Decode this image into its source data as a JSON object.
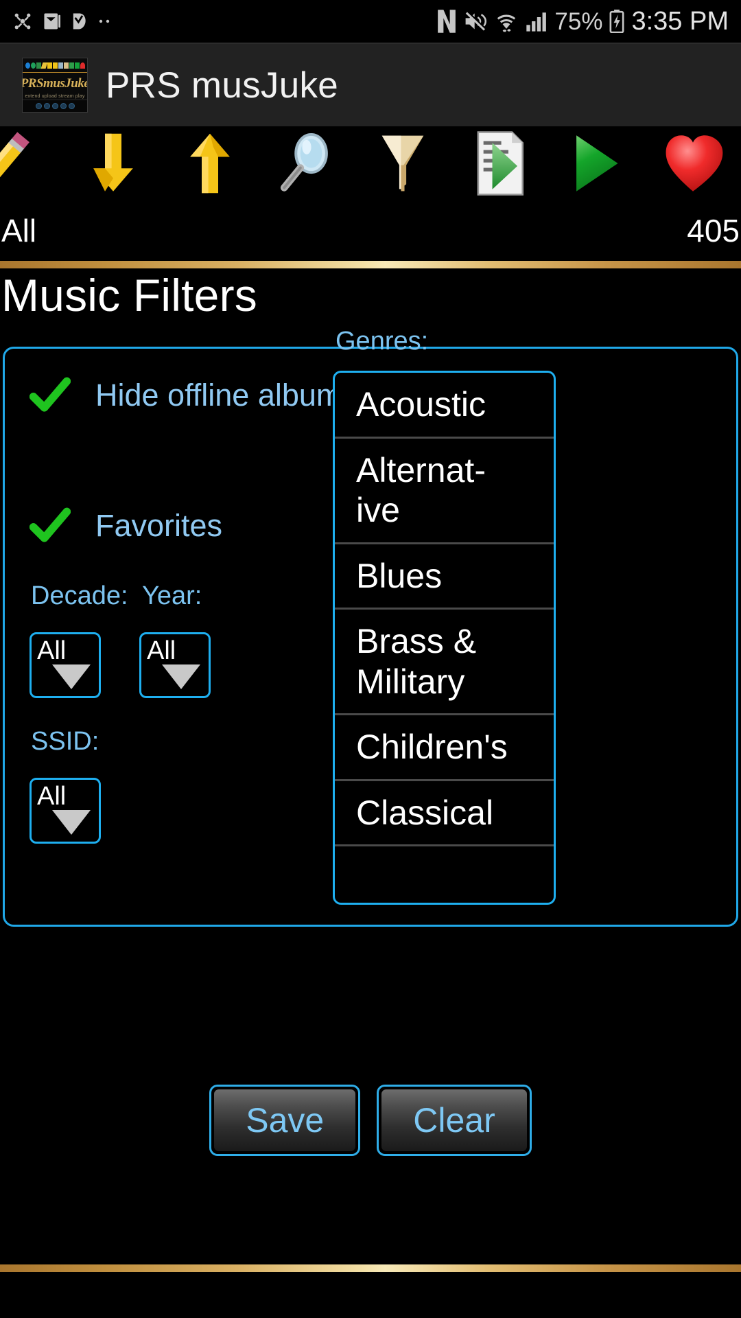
{
  "statusbar": {
    "left_icons": [
      "bluetooth-share-icon",
      "email-icon",
      "download-check-icon",
      "more-dots-icon"
    ],
    "right_icons": [
      "nfc-icon",
      "mute-icon",
      "wifi-icon",
      "signal-icon",
      "battery-charging-icon"
    ],
    "battery_level": "75%",
    "time": "3:35 PM"
  },
  "appbar": {
    "title": "PRS musJuke",
    "logo": {
      "wordmark": "PRSmusJuke",
      "tagline": "extend upload stream play"
    }
  },
  "toolbar": {
    "items": [
      {
        "name": "edit-pencil-icon",
        "label": "Edit"
      },
      {
        "name": "download-arrow-icon",
        "label": "Download"
      },
      {
        "name": "upload-arrow-icon",
        "label": "Upload"
      },
      {
        "name": "search-icon",
        "label": "Search"
      },
      {
        "name": "filter-funnel-icon",
        "label": "Filter"
      },
      {
        "name": "playlist-icon",
        "label": "Playlist"
      },
      {
        "name": "play-icon",
        "label": "Play"
      },
      {
        "name": "favorite-heart-icon",
        "label": "Favorites"
      }
    ]
  },
  "summary": {
    "filter_label": "All",
    "count": "405"
  },
  "page": {
    "title": "Music Filters"
  },
  "filters": {
    "checkboxes": [
      {
        "label": "Hide offline albums",
        "checked": true
      },
      {
        "label": "Favorites",
        "checked": true
      }
    ],
    "decade": {
      "label": "Decade:",
      "value": "All"
    },
    "year": {
      "label": "Year:",
      "value": "All"
    },
    "ssid": {
      "label": "SSID:",
      "value": "All"
    },
    "genres": {
      "label": "Genres:",
      "items": [
        {
          "text": "Acoustic",
          "line1": "Acoustic",
          "line2": ""
        },
        {
          "text": "Alternative",
          "line1": "Alternat-",
          "line2": "ive"
        },
        {
          "text": "Blues",
          "line1": "Blues",
          "line2": ""
        },
        {
          "text": "Brass & Military",
          "line1": "Brass &",
          "line2": "Military"
        },
        {
          "text": "Children's",
          "line1": "Children's",
          "line2": ""
        },
        {
          "text": "Classical",
          "line1": "Classical",
          "line2": ""
        }
      ]
    }
  },
  "actions": {
    "save_label": "Save",
    "clear_label": "Clear"
  },
  "colors": {
    "accent_cyan": "#1eaff0",
    "label_blue": "#7cc3f0",
    "check_green": "#1fc41f",
    "gold": "#d9b063",
    "background": "#000000"
  }
}
